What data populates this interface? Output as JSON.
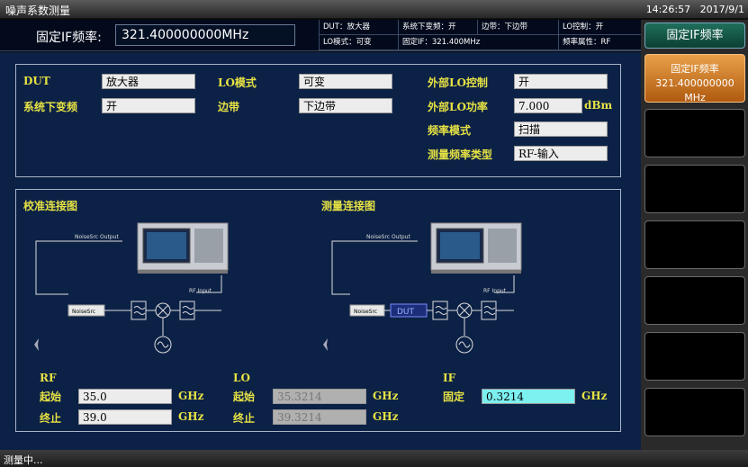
{
  "window": {
    "title": "噪声系数测量",
    "time": "14:26:57",
    "date": "2017/9/1"
  },
  "infobar": {
    "if_label": "固定IF频率:",
    "if_value": "321.400000000MHz",
    "status": {
      "dut": "DUT：放大器",
      "downconv": "系统下变频：开",
      "sideband": "边带：下边带",
      "lo_control": "LO控制：开",
      "lo_mode": "LO模式：可变",
      "fixed_if": "固定IF：321.400MHz",
      "freq_attr": "频率属性：RF"
    }
  },
  "softkeys": {
    "header": "固定IF频率",
    "selected_line1": "固定IF频率",
    "selected_line2": "321.400000000 MHz"
  },
  "config": {
    "dut_label": "DUT",
    "dut_value": "放大器",
    "lo_mode_label": "LO模式",
    "lo_mode_value": "可变",
    "ext_lo_ctrl_label": "外部LO控制",
    "ext_lo_ctrl_value": "开",
    "sys_downconv_label": "系统下变频",
    "sys_downconv_value": "开",
    "sideband_label": "边带",
    "sideband_value": "下边带",
    "ext_lo_power_label": "外部LO功率",
    "ext_lo_power_value": "7.000",
    "ext_lo_power_unit": "dBm",
    "freq_mode_label": "频率模式",
    "freq_mode_value": "扫描",
    "meas_freq_type_label": "测量频率类型",
    "meas_freq_type_value": "RF-输入"
  },
  "diagrams": {
    "cal_title": "校准连接图",
    "meas_title": "测量连接图",
    "noisesrc_output": "NoiseSrc Output",
    "noisesrc_box": "NoiseSrc",
    "rf_input": "RF Input",
    "dut_box": "DUT"
  },
  "freq": {
    "rf_label": "RF",
    "lo_label": "LO",
    "if_label": "IF",
    "start_label": "起始",
    "stop_label": "终止",
    "fixed_label": "固定",
    "rf_start": "35.0",
    "rf_stop": "39.0",
    "lo_start": "35.3214",
    "lo_stop": "39.3214",
    "if_fixed": "0.3214",
    "unit": "GHz"
  },
  "status_text": "测量中..."
}
